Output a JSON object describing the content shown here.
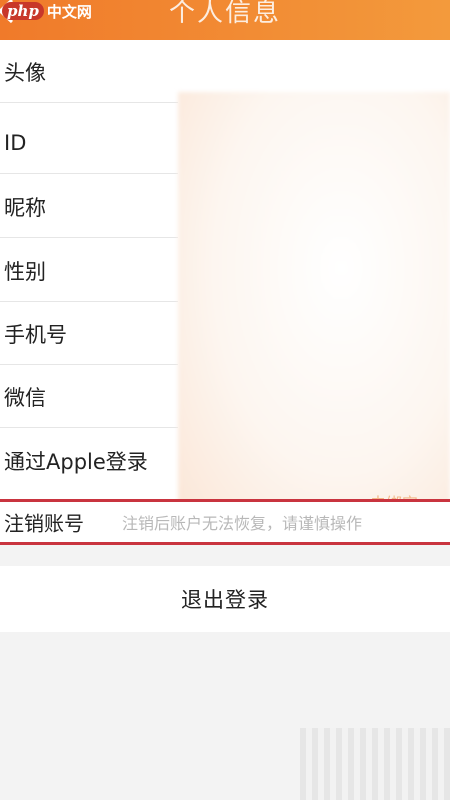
{
  "watermark": {
    "badge": "php",
    "text": "中文网"
  },
  "header": {
    "title": "个人信息"
  },
  "rows": [
    {
      "label": "头像"
    },
    {
      "label": "ID"
    },
    {
      "label": "昵称"
    },
    {
      "label": "性别"
    },
    {
      "label": "手机号"
    },
    {
      "label": "微信"
    },
    {
      "label": "通过Apple登录"
    }
  ],
  "apple_value_partial": "未绑定",
  "cancel_account": {
    "label": "注销账号",
    "hint": "注销后账户无法恢复，请谨慎操作"
  },
  "logout": {
    "label": "退出登录"
  },
  "colors": {
    "header_start": "#f07a2a",
    "header_end": "#f39a3c",
    "highlight": "#c9343f"
  }
}
